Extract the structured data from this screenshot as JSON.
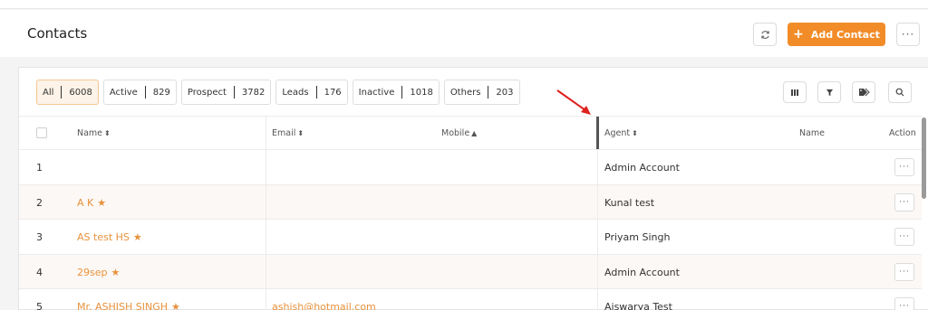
{
  "header": {
    "title": "Contacts",
    "add_label": "Add Contact",
    "icons": {
      "refresh": "refresh-icon",
      "more": "more-icon",
      "plus": "plus-icon"
    }
  },
  "filters": [
    {
      "label": "All",
      "count": "6008",
      "active": true
    },
    {
      "label": "Active",
      "count": "829"
    },
    {
      "label": "Prospect",
      "count": "3782"
    },
    {
      "label": "Leads",
      "count": "176"
    },
    {
      "label": "Inactive",
      "count": "1018"
    },
    {
      "label": "Others",
      "count": "203"
    }
  ],
  "toolbar": {
    "icons": [
      "columns-icon",
      "filter-icon",
      "tag-icon",
      "search-icon"
    ]
  },
  "table": {
    "columns": {
      "name": "Name",
      "email": "Email",
      "mobile": "Mobile",
      "agent": "Agent",
      "agent_name": "Name",
      "action": "Action"
    },
    "rows": [
      {
        "id": "1",
        "name": "",
        "email": "",
        "agent": "Admin Account"
      },
      {
        "id": "2",
        "name": "A K",
        "email": "",
        "agent": "Kunal test"
      },
      {
        "id": "3",
        "name": "AS test HS",
        "email": "",
        "agent": "Priyam Singh"
      },
      {
        "id": "4",
        "name": "29sep",
        "email": "",
        "agent": "Admin Account"
      },
      {
        "id": "5",
        "name": "Mr. ASHISH SINGH",
        "email": "ashish@hotmail.com",
        "agent": "Aiswarya Test"
      }
    ]
  },
  "colors": {
    "accent": "#f28c28",
    "link": "#e8923c",
    "annotation": "#e0201c"
  }
}
